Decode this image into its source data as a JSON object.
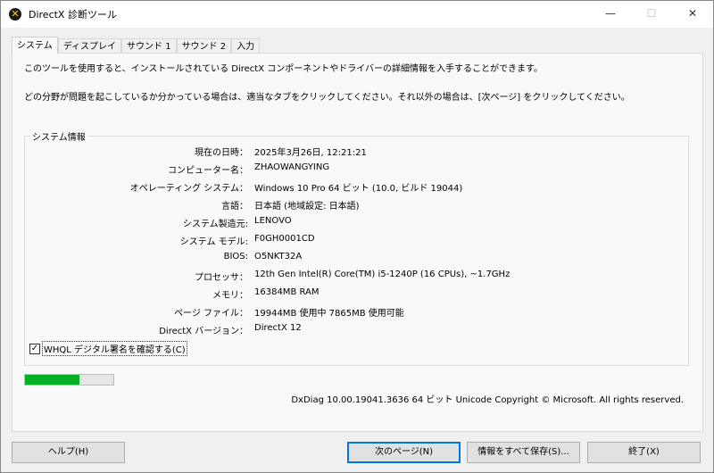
{
  "window": {
    "title": "DirectX 診断ツール",
    "minimize": "—",
    "maximize": "☐",
    "close": "✕"
  },
  "tabs": [
    "システム",
    "ディスプレイ",
    "サウンド 1",
    "サウンド 2",
    "入力"
  ],
  "intro": [
    "このツールを使用すると、インストールされている DirectX コンポーネントやドライバーの詳細情報を入手することができます。",
    "どの分野が問題を起こしているか分かっている場合は、適当なタブをクリックしてください。それ以外の場合は、[次ページ] をクリックしてください。"
  ],
  "system_info": {
    "title": "システム情報",
    "rows": [
      {
        "label": "現在の日時：",
        "value": "2025年3月26日, 12:21:21"
      },
      {
        "label": "コンピューター名：",
        "value": "ZHAOWANGYING"
      },
      {
        "label": "オペレーティング システム：",
        "value": "Windows 10 Pro 64 ビット (10.0, ビルド 19044)"
      },
      {
        "label": "言語：",
        "value": "日本語 (地域設定: 日本語)"
      },
      {
        "label": "システム製造元:",
        "value": "LENOVO"
      },
      {
        "label": "システム モデル:",
        "value": "F0GH0001CD"
      },
      {
        "label": "BIOS:",
        "value": "O5NKT32A"
      },
      {
        "label": "プロセッサ：",
        "value": "12th Gen Intel(R) Core(TM) i5-1240P (16 CPUs), ~1.7GHz"
      },
      {
        "label": "メモリ：",
        "value": "16384MB RAM"
      },
      {
        "label": "ページ ファイル：",
        "value": "19944MB 使用中 7865MB 使用可能"
      },
      {
        "label": "DirectX バージョン：",
        "value": "DirectX 12"
      }
    ]
  },
  "whql": {
    "label": "WHQL デジタル署名を確認する(C)",
    "checked": true,
    "mark": "✓"
  },
  "progress": {
    "percent": 62,
    "color": "#06b025"
  },
  "copyright": "DxDiag 10.00.19041.3636 64 ビット Unicode  Copyright © Microsoft. All rights reserved.",
  "buttons": {
    "help": "ヘルプ(H)",
    "next": "次のページ(N)",
    "save": "情報をすべて保存(S)...",
    "exit": "終了(X)"
  }
}
